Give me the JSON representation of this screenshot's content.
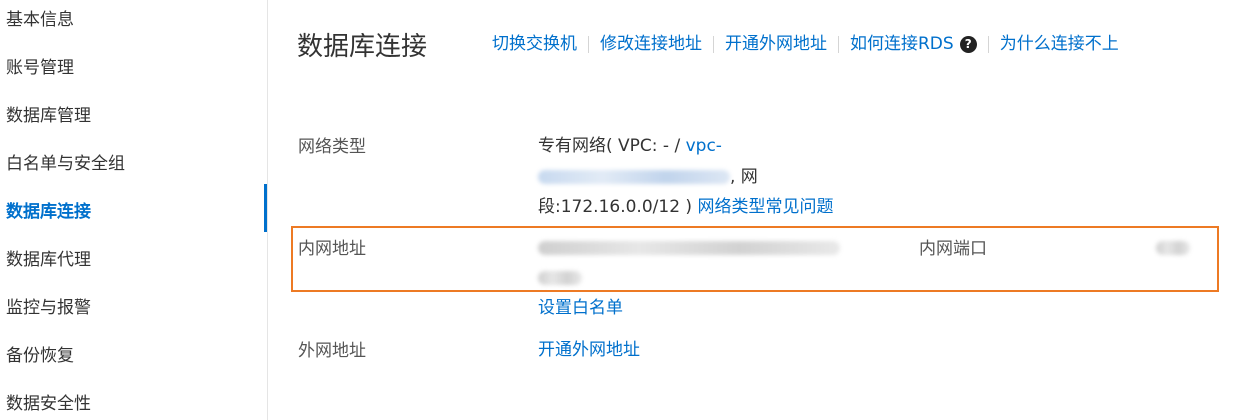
{
  "sidebar": {
    "items": [
      {
        "label": "基本信息"
      },
      {
        "label": "账号管理"
      },
      {
        "label": "数据库管理"
      },
      {
        "label": "白名单与安全组"
      },
      {
        "label": "数据库连接"
      },
      {
        "label": "数据库代理"
      },
      {
        "label": "监控与报警"
      },
      {
        "label": "备份恢复"
      },
      {
        "label": "数据安全性"
      }
    ],
    "active_index": 4
  },
  "main": {
    "title": "数据库连接",
    "toolbar": {
      "switch_vswitch": "切换交换机",
      "modify_address": "修改连接地址",
      "open_public": "开通外网地址",
      "how_to_connect": "如何连接RDS",
      "why_cannot_connect": "为什么连接不上"
    },
    "network_type": {
      "label": "网络类型",
      "value_prefix": "专有网络( VPC: - / ",
      "vpc_prefix": "vpc-",
      "line2_suffix": ", 网",
      "line3_prefix": "段:172.16.0.0/12 )",
      "faq_link": "网络类型常见问题"
    },
    "internal_address": {
      "label": "内网地址",
      "port_label": "内网端口",
      "whitelist_link": "设置白名单"
    },
    "public_address": {
      "label": "外网地址",
      "open_link": "开通外网地址"
    }
  },
  "colors": {
    "accent": "#0070cc",
    "highlight_border": "#ed7a24"
  }
}
